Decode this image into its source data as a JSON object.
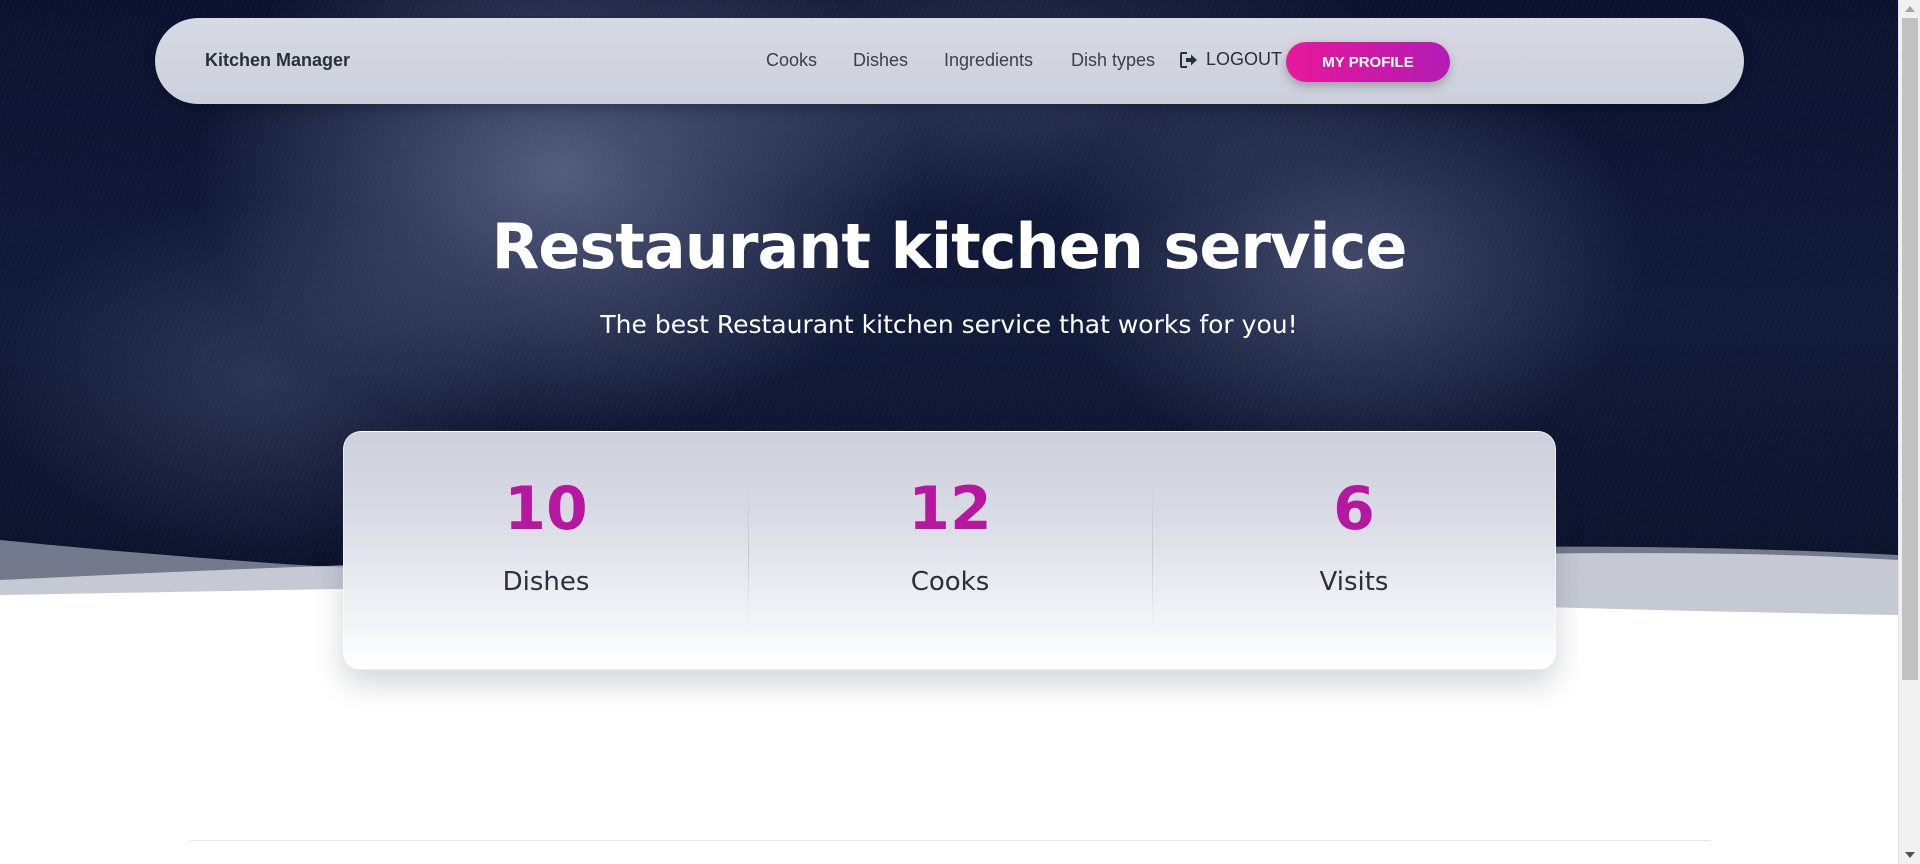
{
  "navbar": {
    "brand": "Kitchen Manager",
    "links": [
      "Cooks",
      "Dishes",
      "Ingredients",
      "Dish types"
    ],
    "logout_label": "LOGOUT",
    "logout_icon": "logout-icon",
    "profile_label": "MY PROFILE"
  },
  "hero": {
    "title": "Restaurant kitchen service",
    "subtitle": "The best Restaurant kitchen service that works for you!"
  },
  "stats": [
    {
      "value": "10",
      "label": "Dishes"
    },
    {
      "value": "12",
      "label": "Cooks"
    },
    {
      "value": "6",
      "label": "Visits"
    }
  ],
  "colors": {
    "accent": "#b5179f",
    "button_start": "#e8179a",
    "button_end": "#b21cb4",
    "hero_bg": "#0b1230"
  },
  "scrollbar": {
    "thumb_fraction": 0.8
  }
}
